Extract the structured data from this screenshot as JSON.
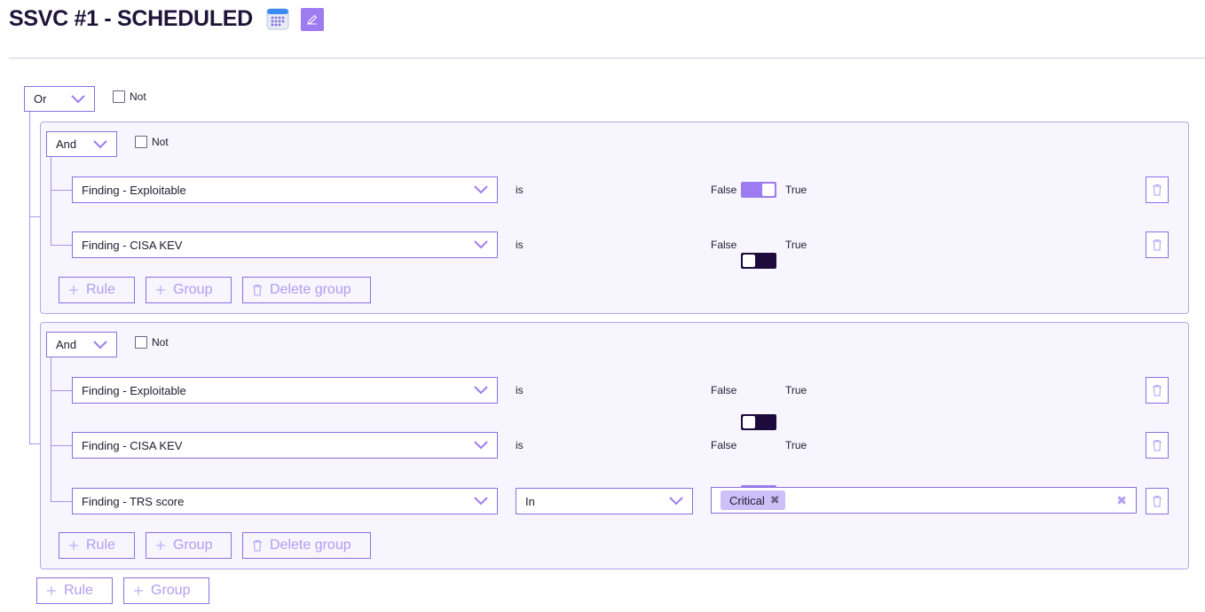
{
  "header": {
    "title": "SSVC #1 - SCHEDULED",
    "calendar_icon": "calendar-icon",
    "edit_icon": "pencil-icon",
    "accent": "#9d7cf2"
  },
  "root": {
    "combinator": "Or",
    "not_label": "Not",
    "rule_label": "Rule",
    "group_label": "Group"
  },
  "groups": [
    {
      "combinator": "And",
      "not_label": "Not",
      "rules": [
        {
          "field": "Finding - Exploitable",
          "operator": "is",
          "false_label": "False",
          "true_label": "True",
          "value": true
        },
        {
          "field": "Finding - CISA KEV",
          "operator": "is",
          "false_label": "False",
          "true_label": "True",
          "value": false
        }
      ],
      "rule_label": "Rule",
      "group_label": "Group",
      "delete_label": "Delete group"
    },
    {
      "combinator": "And",
      "not_label": "Not",
      "rules": [
        {
          "field": "Finding - Exploitable",
          "operator": "is",
          "false_label": "False",
          "true_label": "True",
          "value": false
        },
        {
          "field": "Finding - CISA KEV",
          "operator": "is",
          "false_label": "False",
          "true_label": "True",
          "value": true
        },
        {
          "field": "Finding - TRS score",
          "operator": "In",
          "values": [
            "Critical"
          ]
        }
      ],
      "rule_label": "Rule",
      "group_label": "Group",
      "delete_label": "Delete group"
    }
  ]
}
